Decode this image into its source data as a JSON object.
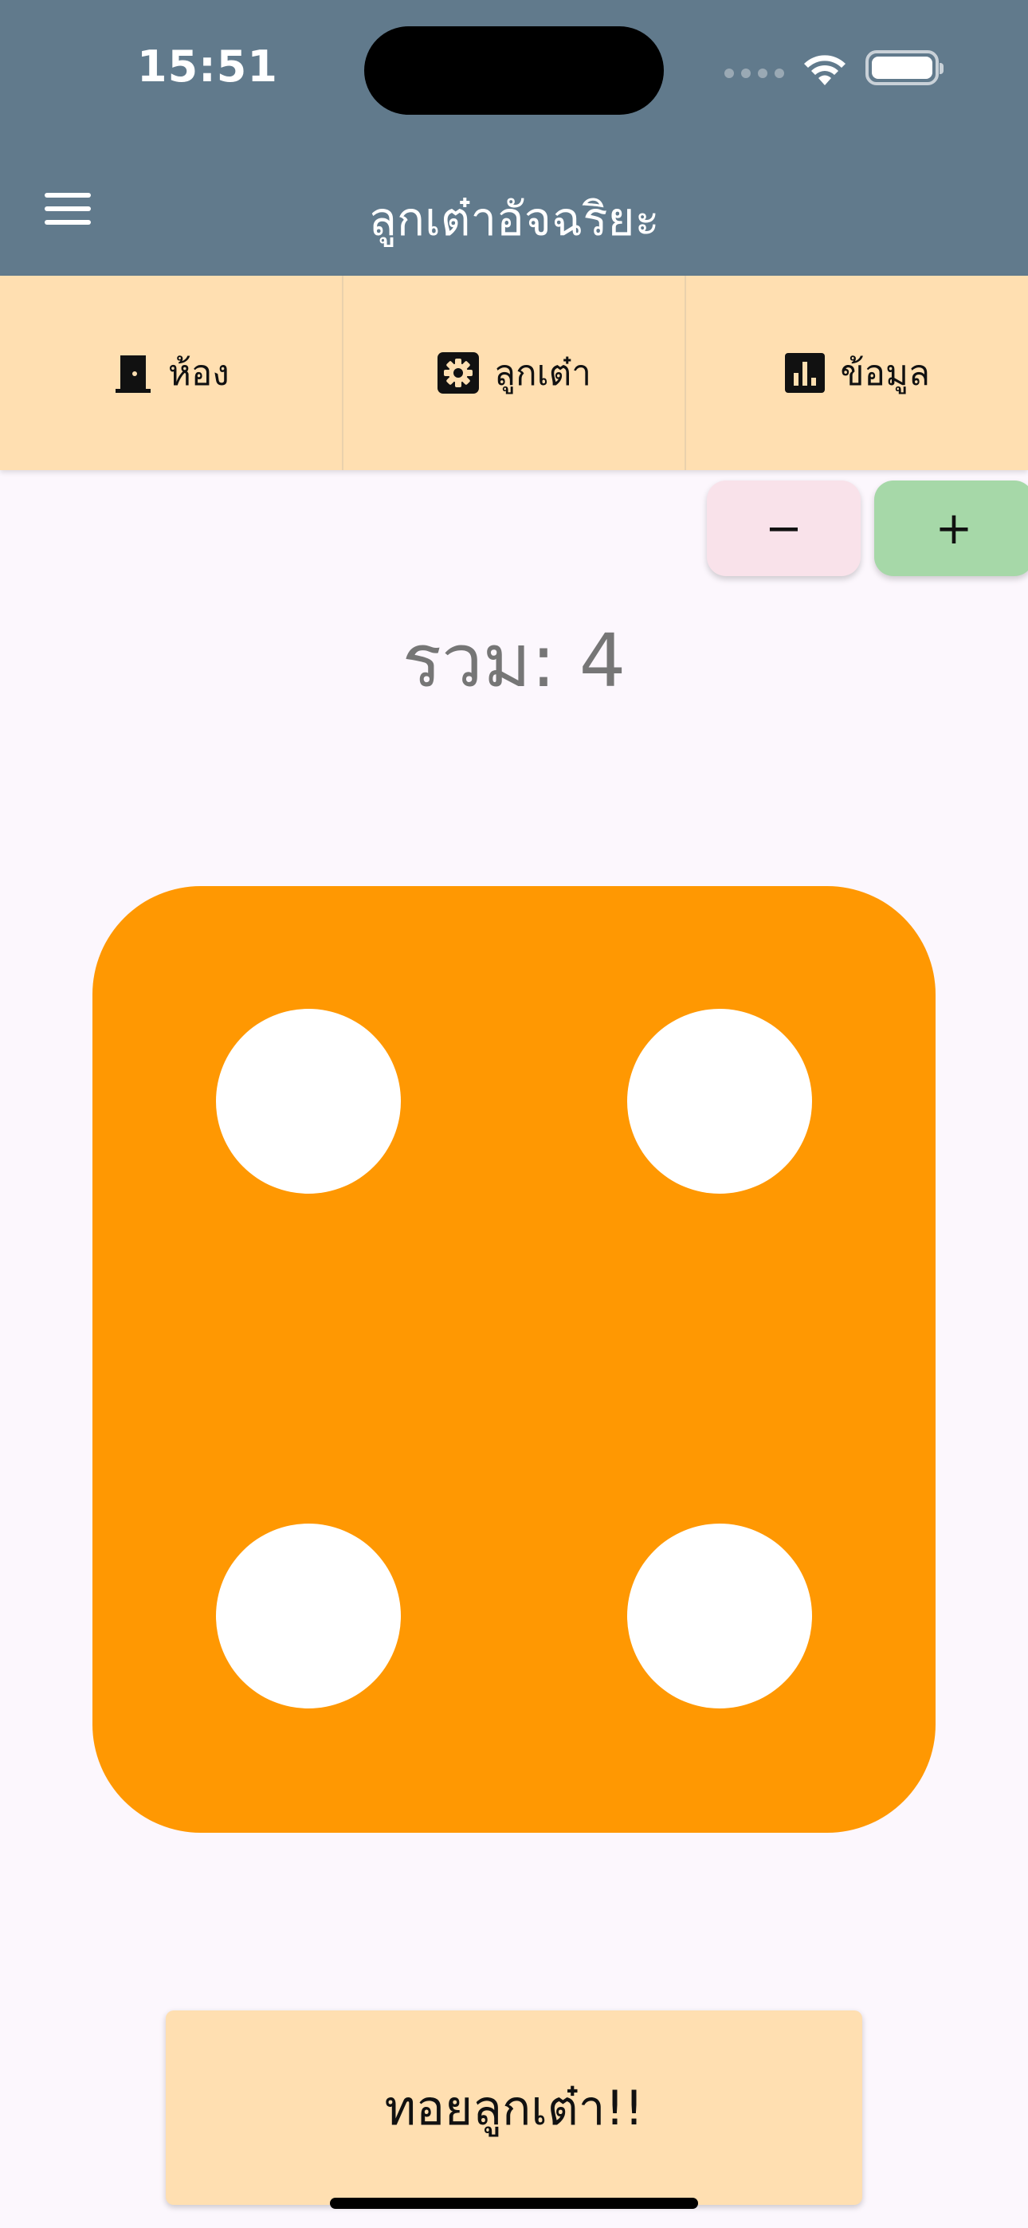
{
  "status_bar": {
    "time": "15:51"
  },
  "header": {
    "title": "ลูกเต๋าอัจฉริยะ",
    "menu_icon": "hamburger-menu-icon",
    "background_color": "#617a8c"
  },
  "tabs": [
    {
      "label": "ห้อง",
      "icon": "door-icon"
    },
    {
      "label": "ลูกเต๋า",
      "icon": "gear-icon"
    },
    {
      "label": "ข้อมูล",
      "icon": "bar-chart-icon"
    }
  ],
  "stepper": {
    "minus_label": "−",
    "plus_label": "+"
  },
  "total": {
    "text": "รวม: 4",
    "value": 4
  },
  "die": {
    "face_value": 4,
    "color": "#ff9802",
    "pip_color": "#ffffff"
  },
  "roll_button": {
    "label": "ทอยลูกเต๋า!!"
  },
  "colors": {
    "accent_tab_bg": "#ffdfb1",
    "page_bg": "#fcf7fd",
    "minus_bg": "#f9e2ea",
    "plus_bg": "#a6d8a8"
  }
}
